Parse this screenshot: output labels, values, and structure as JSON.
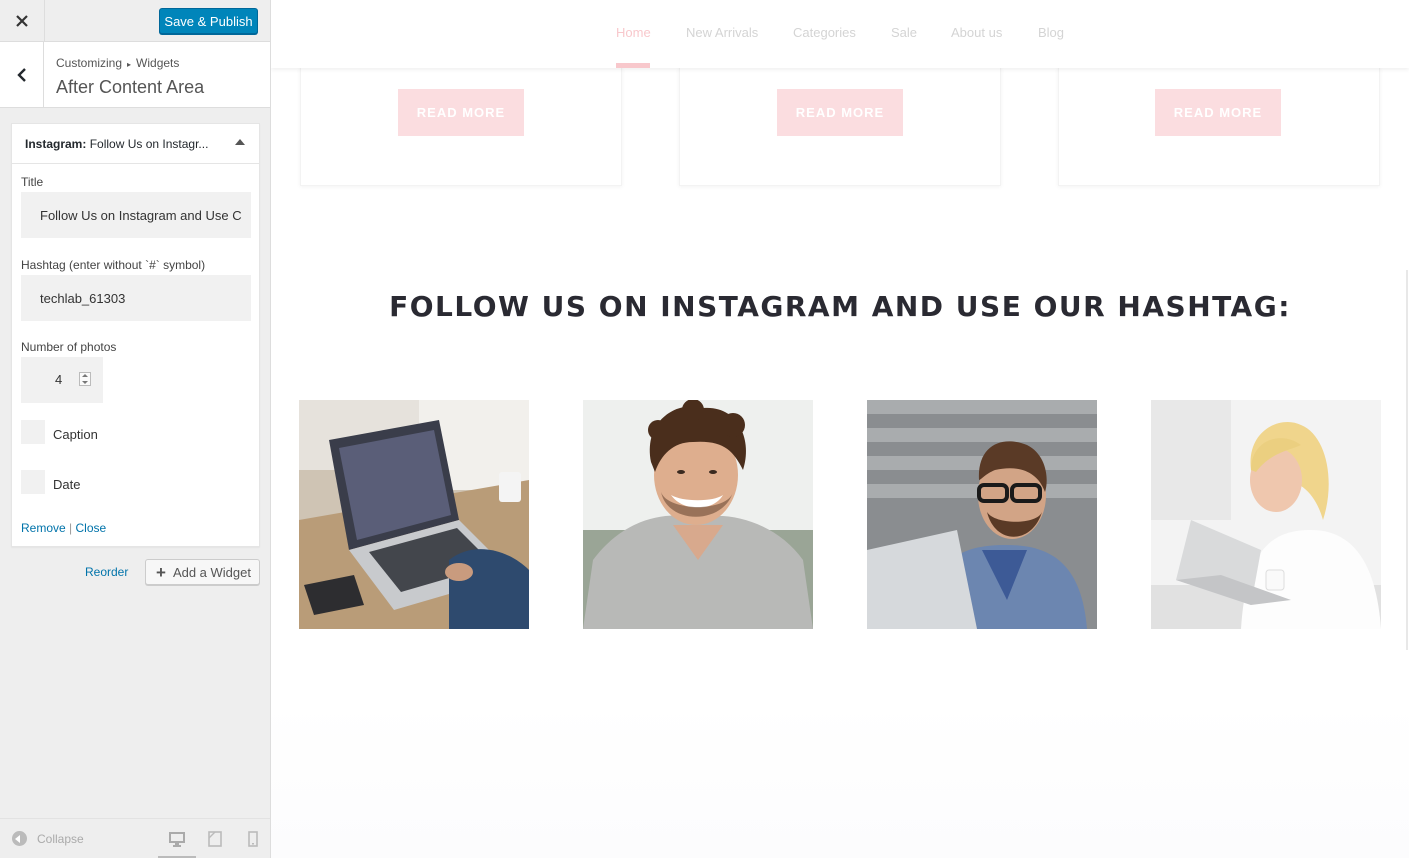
{
  "sidebar": {
    "close_icon": "close-icon",
    "publish_label": "Save & Publish",
    "breadcrumb": {
      "root": "Customizing",
      "separator": "▸",
      "current": "Widgets"
    },
    "section_title": "After Content Area",
    "widget": {
      "type": "Instagram:",
      "name": "Follow Us on Instagr...",
      "fields": {
        "title_label": "Title",
        "title_value": "Follow Us on Instagram and Use C",
        "hashtag_label": "Hashtag (enter without `#` symbol)",
        "hashtag_value": "techlab_61303",
        "photos_label": "Number of photos",
        "photos_value": "4",
        "caption_label": "Caption",
        "date_label": "Date"
      },
      "actions": {
        "remove": "Remove",
        "separator": " | ",
        "close": "Close"
      }
    },
    "reorder_label": "Reorder",
    "add_widget_label": "Add a Widget",
    "footer": {
      "collapse_label": "Collapse",
      "devices": [
        "desktop-icon",
        "tablet-icon",
        "mobile-icon"
      ]
    }
  },
  "preview": {
    "nav": [
      "Home",
      "New Arrivals",
      "Categories",
      "Sale",
      "About us",
      "Blog"
    ],
    "active_nav": "Home",
    "read_more_label": "READ MORE",
    "heading": "FOLLOW US ON INSTAGRAM AND USE OUR HASHTAG:",
    "photos": [
      "laptop-photo",
      "smiling-man-photo",
      "man-with-glasses-photo",
      "woman-with-laptop-photo"
    ],
    "colors": {
      "accent": "#f8c8cc",
      "button": "#fbdde0",
      "wp_blue": "#0085ba",
      "heading": "#2a2a32"
    }
  }
}
